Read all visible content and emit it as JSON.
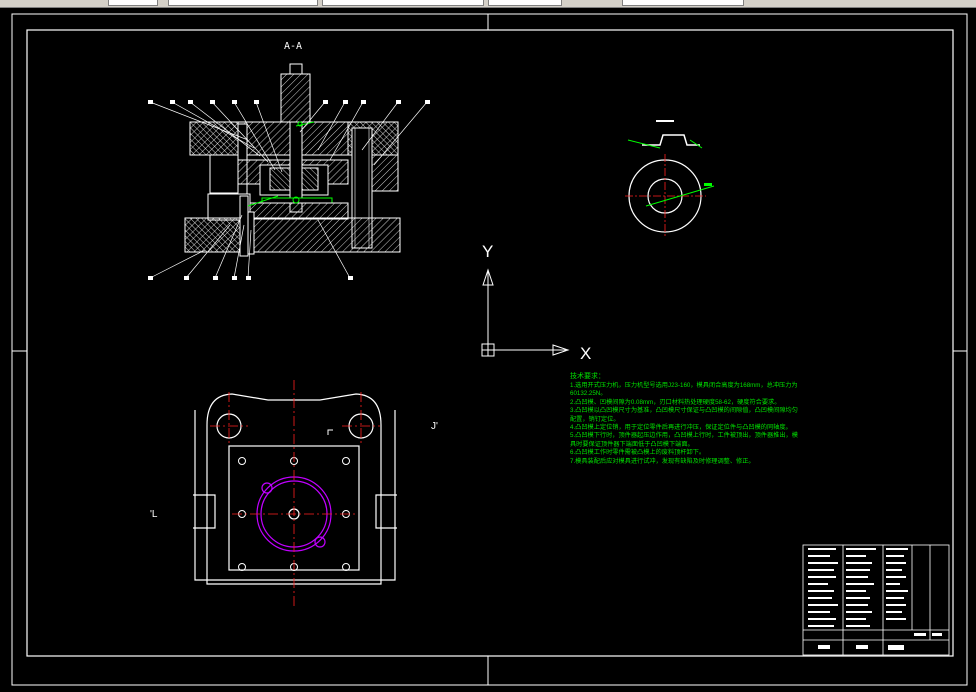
{
  "section_label": "A-A",
  "axes": {
    "y": "Y",
    "x": "X"
  },
  "view_marks": {
    "left": "'L",
    "right": "J'"
  },
  "tech_requirements": {
    "title": "技术要求：",
    "items": [
      "1.选用开式压力机，压力机型号选用J23-160，模具闭合高度为168mm，总冲压力为60132.25N。",
      "2.凸凹模、凹模间隙为0.08mm，刃口材料热处理硬度58-62，硬度符合要求。",
      "3.凸凹模以凸凹模尺寸为基准，凸凹模尺寸保证与凸凹模的间隙值，凸凹模间隙均匀配置，销钉定位。",
      "4.凸凹模上定位销，用于定位零件后再进行冲压，保证定位件与凸凹模的同轴度。",
      "5.凸凹模下行时，顶件器起压边作用，凸凹模上行时，工件被顶出，顶件器推出，模具时要保证顶件器下端面低于凸凹模下端面。",
      "6.凸凹模工作时零件需被凸模上的废料顶杆卸下。",
      "7.模具装配后应对模具进行试冲，发现有缺陷及时修理调整、修正。"
    ]
  },
  "colors": {
    "outline": "#ffffff",
    "centerline": "#ff2020",
    "dimension": "#00ff00",
    "note": "#00e000",
    "feature": "#c000ff"
  }
}
